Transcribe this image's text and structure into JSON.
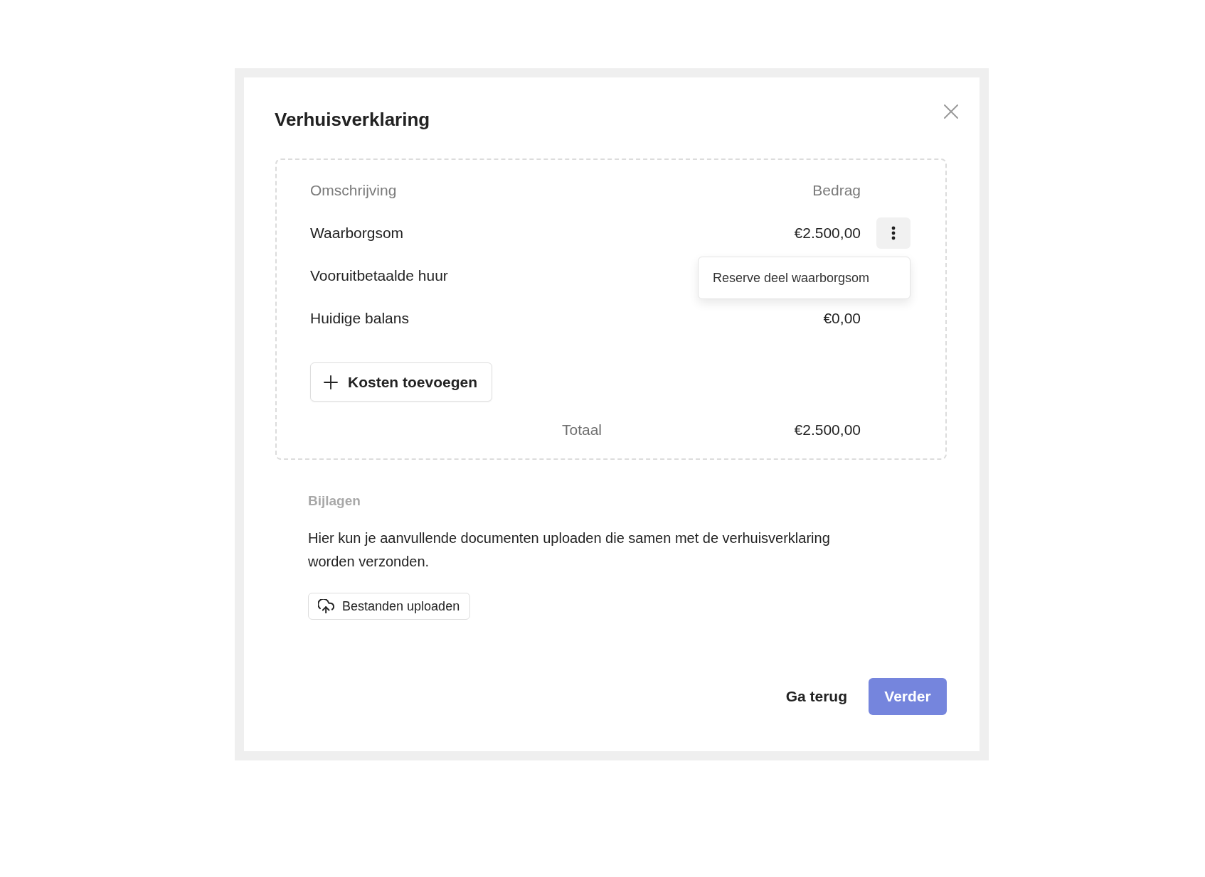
{
  "dialog": {
    "title": "Verhuisverklaring"
  },
  "costs": {
    "columns": [
      "Omschrijving",
      "Bedrag"
    ],
    "rows": [
      {
        "description": "Waarborgsom",
        "amount": "€2.500,00",
        "actions_menu": {
          "open": true,
          "items": [
            {
              "label": "Reserve deel waarborgsom"
            }
          ]
        }
      },
      {
        "description": "Vooruitbetaalde huur"
      },
      {
        "description": "Huidige balans",
        "amount": "€0,00"
      }
    ],
    "add_button": "Kosten toevoegen",
    "total_label": "Totaal",
    "total_amount": "€2.500,00"
  },
  "attachments": {
    "heading": "Bijlagen",
    "description": "Hier kun je aanvullende documenten uploaden die samen met de verhuisverklaring worden verzonden.",
    "upload_button": "Bestanden uploaden"
  },
  "footer": {
    "buttons": [
      {
        "label": "Ga terug",
        "kind": "secondary"
      },
      {
        "label": "Verder",
        "kind": "primary"
      }
    ]
  }
}
